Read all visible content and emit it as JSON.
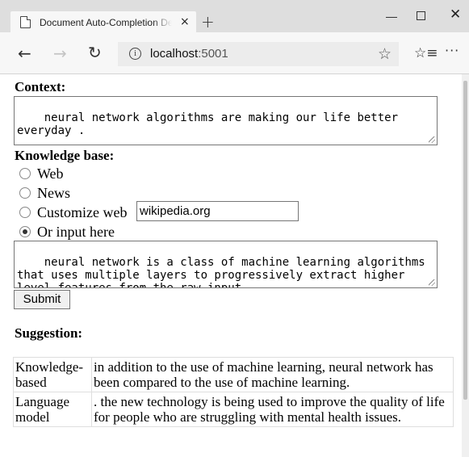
{
  "browser": {
    "tab_title": "Document Auto-Completion Demo",
    "tab_close": "×",
    "new_tab": "+",
    "minimize": "—",
    "maximize": "",
    "close": "✕",
    "back": "←",
    "forward": "→",
    "refresh": "↻",
    "info": "i",
    "url_host": "localhost",
    "url_port": ":5001",
    "star": "☆",
    "favorites": "☆≡",
    "more": "···"
  },
  "form": {
    "context_heading": "Context:",
    "context_value": "neural network algorithms are making our life better everyday .",
    "kb_heading": "Knowledge base:",
    "options": [
      {
        "label": "Web",
        "checked": false
      },
      {
        "label": "News",
        "checked": false
      },
      {
        "label": "Customize web",
        "checked": false
      },
      {
        "label": "Or input here",
        "checked": true
      }
    ],
    "custom_web_value": "wikipedia.org",
    "kb_input_value": "neural network is a class of machine learning algorithms that uses multiple layers to progressively extract higher level features from the raw input.",
    "submit_label": "Submit"
  },
  "suggestion": {
    "heading": "Suggestion:",
    "rows": [
      {
        "source": "Knowledge-based",
        "text": "in addition to the use of machine learning, neural network has been compared to the use of machine learning."
      },
      {
        "source": "Language model",
        "text": ". the new technology is being used to improve the quality of life for people who are struggling with mental health issues."
      }
    ]
  }
}
